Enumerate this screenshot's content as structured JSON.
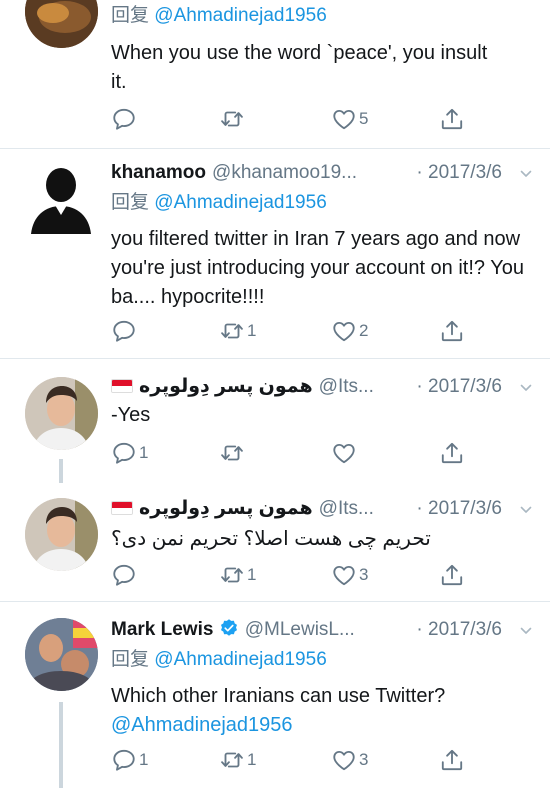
{
  "tweets": [
    {
      "reply_prefix": "回复",
      "reply_to": "@Ahmadinejad1956",
      "text": "When you use the word `peace', you insult it.",
      "counts": {
        "reply": "",
        "retweet": "",
        "like": "5"
      }
    },
    {
      "name": "khanamoo",
      "handle": "@khanamoo19...",
      "date": "· 2017/3/6",
      "reply_prefix": "回复",
      "reply_to": "@Ahmadinejad1956",
      "text": "you filtered twitter in Iran 7 years ago and now you're just introducing your account on it!? You ba.... hypocrite!!!!",
      "counts": {
        "reply": "",
        "retweet": "1",
        "like": "2"
      }
    },
    {
      "name": "همون پسر دِولوپره",
      "handle": "@Its...",
      "date": "· 2017/3/6",
      "text": "-Yes",
      "counts": {
        "reply": "1",
        "retweet": "",
        "like": ""
      }
    },
    {
      "name": "همون پسر دِولوپره",
      "handle": "@Its...",
      "date": "· 2017/3/6",
      "text": "تحریم چی هست اصلا؟ تحریم نمن دی؟",
      "counts": {
        "reply": "",
        "retweet": "1",
        "like": "3"
      }
    },
    {
      "name": "Mark Lewis",
      "handle": "@MLewisL...",
      "date": "· 2017/3/6",
      "reply_prefix": "回复",
      "reply_to": "@Ahmadinejad1956",
      "text": "Which other Iranians can use Twitter?",
      "text_mention": "@Ahmadinejad1956",
      "counts": {
        "reply": "1",
        "retweet": "1",
        "like": "3"
      }
    }
  ],
  "colors": {
    "link": "#1b95e0",
    "muted": "#657786",
    "divider": "#e1e8ed",
    "verified": "#1da1f2"
  },
  "icons": [
    "reply-icon",
    "retweet-icon",
    "like-icon",
    "share-icon",
    "caret-down-icon",
    "verified-icon",
    "default-avatar-icon"
  ]
}
